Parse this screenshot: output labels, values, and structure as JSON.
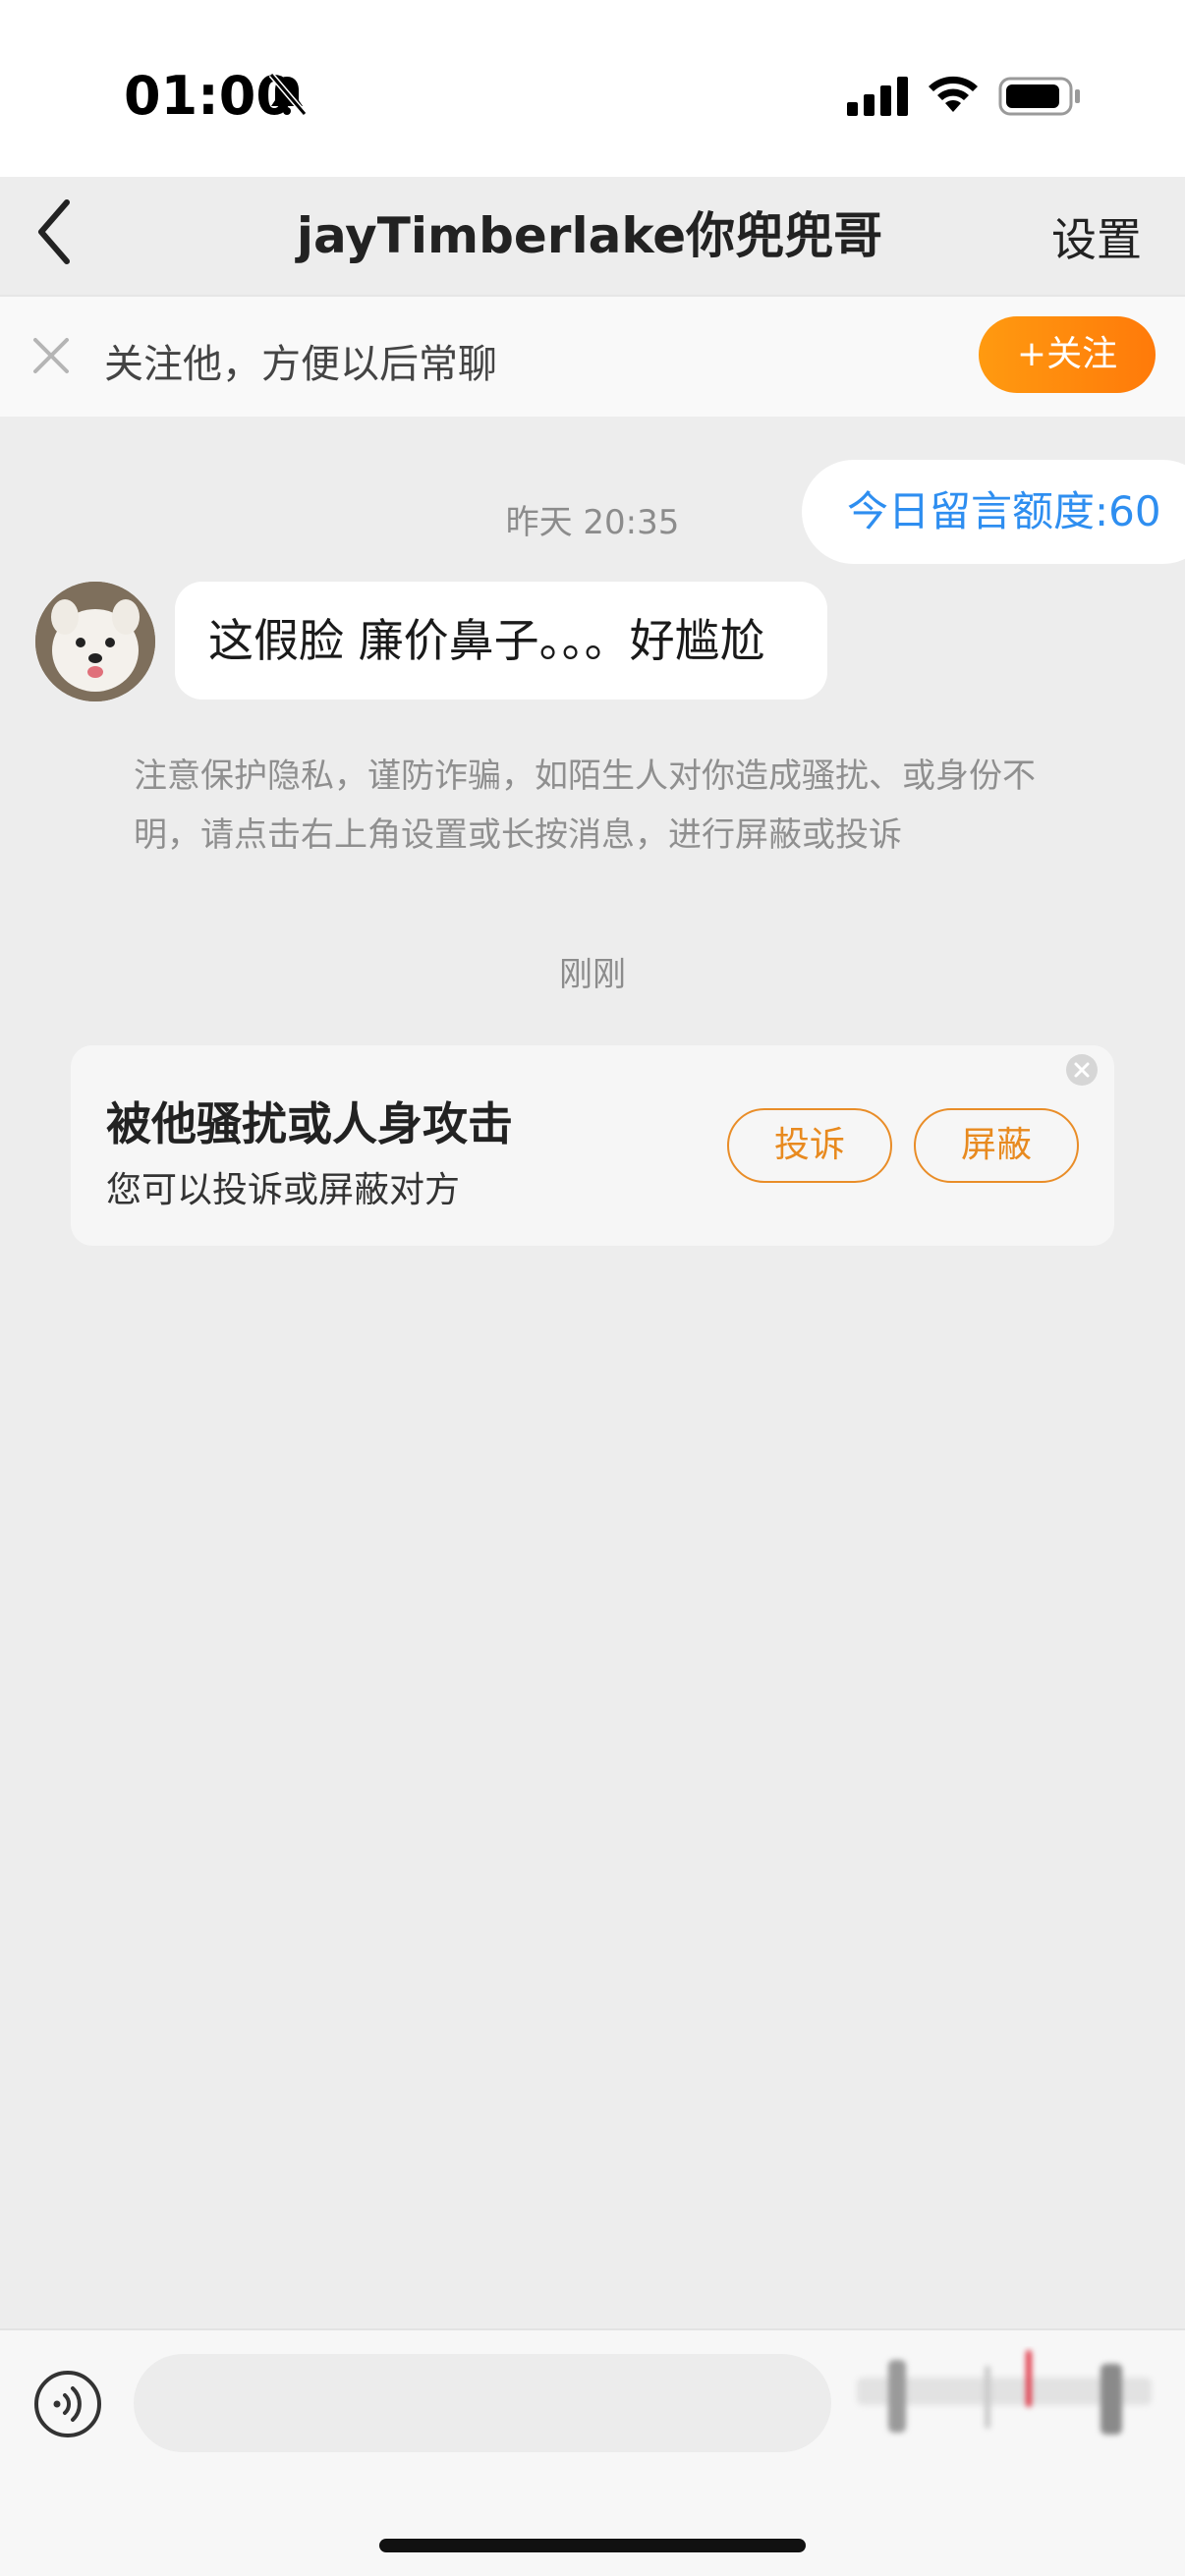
{
  "status_bar": {
    "time": "01:00"
  },
  "nav": {
    "title": "jayTimberlake你兜兜哥",
    "settings_label": "设置"
  },
  "follow_bar": {
    "text": "关注他，方便以后常聊",
    "button_label": "+关注"
  },
  "chat": {
    "quota_text": "今日留言额度:60",
    "time_yesterday": "昨天 20:35",
    "message_text": "这假脸 廉价鼻子。。。好尴尬",
    "privacy_notice": "注意保护隐私，谨防诈骗，如陌生人对你造成骚扰、或身份不明，请点击右上角设置或长按消息，进行屏蔽或投诉",
    "time_now": "刚刚"
  },
  "harassment_card": {
    "title": "被他骚扰或人身攻击",
    "subtitle": "您可以投诉或屏蔽对方",
    "report_label": "投诉",
    "block_label": "屏蔽"
  },
  "input_bar": {
    "placeholder": ""
  },
  "colors": {
    "accent_orange": "#ff8a10",
    "link_blue": "#2e8ef0",
    "background": "#ededed"
  }
}
